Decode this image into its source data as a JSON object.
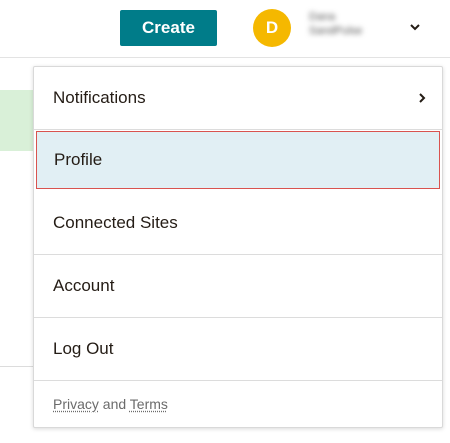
{
  "header": {
    "create_label": "Create",
    "avatar_initial": "D",
    "user_line1": "Dana",
    "user_line2": "SandPulse"
  },
  "menu": {
    "items": [
      {
        "label": "Notifications",
        "has_submenu": true
      },
      {
        "label": "Profile",
        "selected": true
      },
      {
        "label": "Connected Sites"
      },
      {
        "label": "Account"
      },
      {
        "label": "Log Out"
      }
    ],
    "footer": {
      "privacy": "Privacy",
      "and": "and",
      "terms": "Terms"
    }
  },
  "colors": {
    "create_bg": "#007c89",
    "avatar_bg": "#f5b800",
    "selected_bg": "#e1eff4",
    "selected_border": "#d9534f"
  }
}
